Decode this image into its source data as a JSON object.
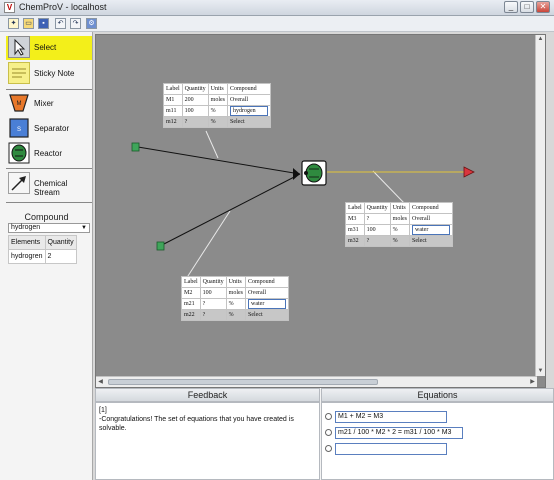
{
  "window": {
    "title": "ChemProV - localhost",
    "icon_letter": "V",
    "controls": {
      "minimize": "_",
      "maximize": "□",
      "close": "✕"
    }
  },
  "toolbar": {
    "icons": [
      "new-file-icon",
      "open-folder-icon",
      "save-icon",
      "undo-icon",
      "redo-icon",
      "settings-icon"
    ]
  },
  "palette": {
    "items": [
      {
        "label": "Select",
        "icon": "cursor-arrow-icon",
        "selected": true
      },
      {
        "label": "Sticky Note",
        "icon": "sticky-note-icon"
      },
      {
        "label": "Mixer",
        "icon": "mixer-icon"
      },
      {
        "label": "Separator",
        "icon": "separator-icon"
      },
      {
        "label": "Reactor",
        "icon": "reactor-icon"
      },
      {
        "label": "Chemical Stream",
        "icon": "stream-arrow-icon"
      }
    ],
    "compound": {
      "title": "Compound",
      "selected": "hydrogen",
      "table_headers": [
        "Elements",
        "Quantity"
      ],
      "rows": [
        [
          "hydrogren",
          "2"
        ]
      ]
    }
  },
  "canvas": {
    "colors": {
      "background": "#8b8b8b",
      "stream_line": "#111111",
      "product_line": "#e3c43a",
      "note_line": "#e8e8e8",
      "source": "#3fa55a",
      "sink": "#d9363e"
    },
    "tables": [
      {
        "headers": [
          "Label",
          "Quantity",
          "Units",
          "Compound"
        ],
        "rows": [
          [
            "M1",
            "200",
            "moles",
            "Overall"
          ],
          [
            "m11",
            "100",
            "%",
            "hydrogen"
          ]
        ],
        "out_row": [
          "m12",
          "?",
          "%",
          "Select"
        ]
      },
      {
        "headers": [
          "Label",
          "Quantity",
          "Units",
          "Compound"
        ],
        "rows": [
          [
            "M3",
            "?",
            "moles",
            "Overall"
          ],
          [
            "m31",
            "100",
            "%",
            "water"
          ]
        ],
        "out_row": [
          "m32",
          "?",
          "%",
          "Select"
        ]
      },
      {
        "headers": [
          "Label",
          "Quantity",
          "Units",
          "Compound"
        ],
        "rows": [
          [
            "M2",
            "100",
            "moles",
            "Overall"
          ],
          [
            "m21",
            "?",
            "%",
            "water"
          ]
        ],
        "out_row": [
          "m22",
          "?",
          "%",
          "Select"
        ]
      }
    ]
  },
  "feedback": {
    "title": "Feedback",
    "line1": "[1]",
    "line2": "-Congratulations! The set of equations that you have created is",
    "line3": "solvable."
  },
  "equations": {
    "title": "Equations",
    "items": [
      "M1 + M2 = M3",
      "m21 / 100 * M2 * 2 = m31 / 100 * M3",
      ""
    ]
  }
}
